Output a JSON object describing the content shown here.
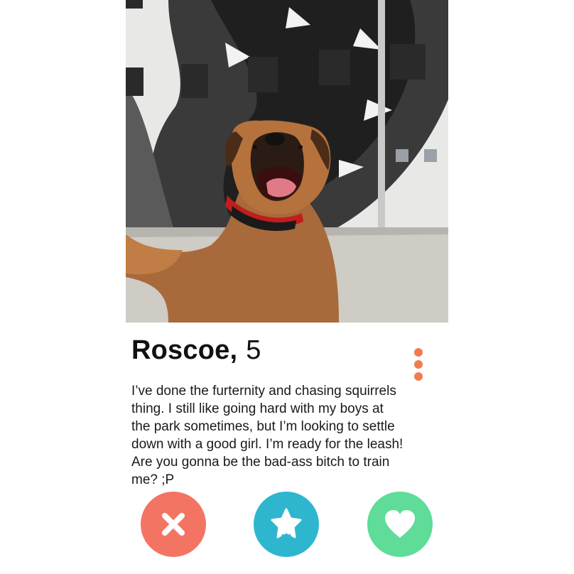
{
  "profile": {
    "name": "Roscoe,",
    "age": "5",
    "bio_lines": [
      "I’ve done the furternity and chasing squirrels",
      "thing. I still like going hard with my boys at",
      "the park sometimes, but I’m looking to settle",
      "down with a good girl. I’m ready for the leash!",
      "Are you gonna be the bad-ass bitch to train",
      "me? ;P"
    ]
  },
  "icons": {
    "menu": "more-vertical-icon",
    "dislike": "close-icon",
    "superlike": "star-icon",
    "like": "heart-icon"
  },
  "colors": {
    "menu_dots": "#f47a4f",
    "dislike": "#f47464",
    "superlike": "#2fb6cf",
    "like": "#5edc98"
  }
}
